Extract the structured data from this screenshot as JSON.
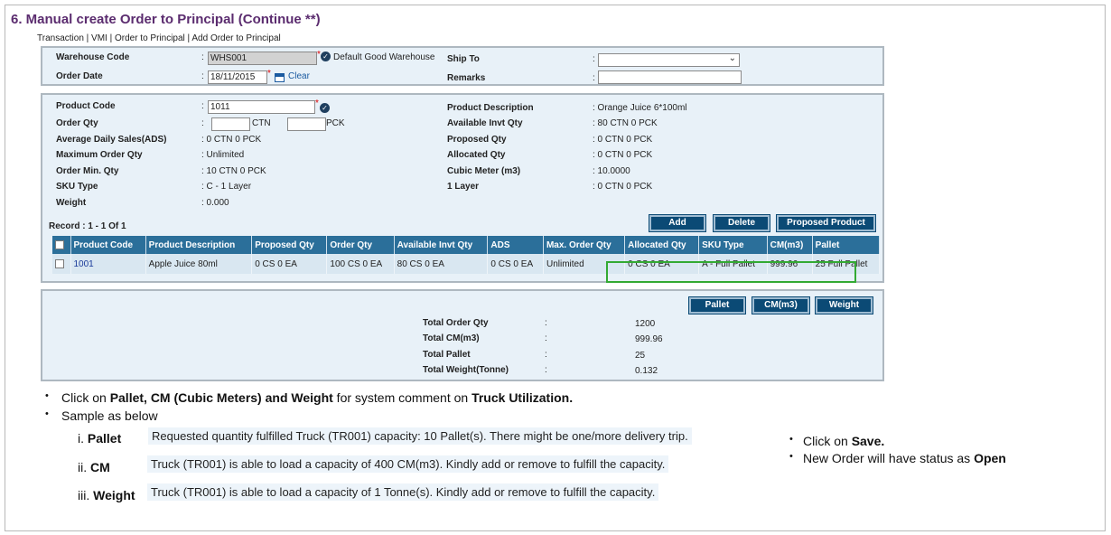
{
  "slide": {
    "title": "6. Manual create Order to Principal (Continue **)"
  },
  "breadcrumb": "Transaction | VMI | Order to Principal | Add Order to Principal",
  "header": {
    "warehouse_code_label": "Warehouse Code",
    "warehouse_code_value": "WHS001",
    "warehouse_name": "Default Good Warehouse",
    "order_date_label": "Order Date",
    "order_date_value": "18/11/2015",
    "clear_label": "Clear",
    "ship_to_label": "Ship To",
    "ship_to_value": "",
    "remarks_label": "Remarks",
    "remarks_value": "",
    "colon": ":"
  },
  "product": {
    "product_code_label": "Product Code",
    "product_code_value": "1011",
    "order_qty_label": "Order Qty",
    "ctn_unit": "CTN",
    "pck_unit": "PCK",
    "ads_label": "Average Daily Sales(ADS)",
    "ads_value": ": 0 CTN 0 PCK",
    "max_order_label": "Maximum Order Qty",
    "max_order_value": ": Unlimited",
    "min_order_label": "Order Min. Qty",
    "min_order_value": ": 10 CTN 0 PCK",
    "sku_type_label": "SKU Type",
    "sku_type_value": ": C - 1 Layer",
    "weight_label": "Weight",
    "weight_value": ": 0.000",
    "desc_label": "Product Description",
    "desc_value": ": Orange Juice 6*100ml",
    "avail_label": "Available Invt Qty",
    "avail_value": ": 80 CTN 0 PCK",
    "proposed_label": "Proposed Qty",
    "proposed_value": ": 0 CTN 0 PCK",
    "allocated_label": "Allocated Qty",
    "allocated_value": ": 0 CTN 0 PCK",
    "cubic_label": "Cubic Meter (m3)",
    "cubic_value": ": 10.0000",
    "layer_label": "1 Layer",
    "layer_value": ": 0 CTN 0 PCK",
    "colon": ":"
  },
  "record_text": "Record : 1 - 1 Of 1",
  "buttons": {
    "add": "Add",
    "delete": "Delete",
    "proposed_product": "Proposed Product",
    "pallet": "Pallet",
    "cm": "CM(m3)",
    "weight": "Weight"
  },
  "table": {
    "headers": [
      "Product Code",
      "Product Description",
      "Proposed Qty",
      "Order Qty",
      "Available Invt Qty",
      "ADS",
      "Max. Order Qty",
      "Allocated Qty",
      "SKU Type",
      "CM(m3)",
      "Pallet"
    ],
    "rows": [
      [
        "1001",
        "Apple Juice 80ml",
        "0 CS 0 EA",
        "100 CS 0 EA",
        "80 CS 0 EA",
        "0 CS 0 EA",
        "Unlimited",
        "0 CS 0 EA",
        "A - Full Pallet",
        "999.96",
        "25 Full Pallet"
      ]
    ]
  },
  "totals": {
    "order_qty_label": "Total Order Qty",
    "order_qty_value": "1200",
    "cm_label": "Total CM(m3)",
    "cm_value": "999.96",
    "pallet_label": "Total Pallet",
    "pallet_value": "25",
    "weight_label": "Total Weight(Tonne)",
    "weight_value": "0.132",
    "colon": ":"
  },
  "notes": {
    "bullet1_pre": "Click on ",
    "bullet1_bold": "Pallet, CM (Cubic Meters) and Weight",
    "bullet1_mid": " for system comment on ",
    "bullet1_bold2": "Truck Utilization.",
    "bullet2": "Sample as below",
    "samples": [
      {
        "num": "i.",
        "label": "Pallet",
        "text": "Requested quantity fulfilled Truck (TR001) capacity: 10 Pallet(s). There might be one/more delivery trip."
      },
      {
        "num": "ii.",
        "label": "CM",
        "text": "Truck (TR001) is able to load a capacity of 400 CM(m3). Kindly add or remove to fulfill the capacity."
      },
      {
        "num": "iii.",
        "label": "Weight",
        "text": "Truck (TR001) is able to load a capacity of 1 Tonne(s). Kindly add or remove to fulfill the capacity."
      }
    ],
    "right1_pre": "Click on ",
    "right1_bold": "Save.",
    "right2_pre": "New Order will have status as ",
    "right2_bold": "Open"
  }
}
